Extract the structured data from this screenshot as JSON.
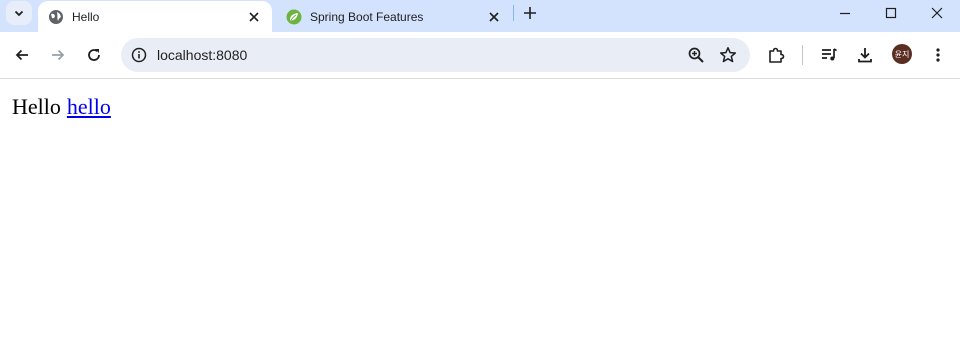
{
  "tabs": [
    {
      "title": "Hello",
      "favicon": "globe-icon",
      "active": true
    },
    {
      "title": "Spring Boot Features",
      "favicon": "spring-leaf-icon",
      "active": false
    }
  ],
  "address_bar": {
    "url": "localhost:8080"
  },
  "profile": {
    "avatar_text": "윤지",
    "color": "#5b2e22"
  },
  "page": {
    "text": "Hello",
    "link_text": "hello"
  },
  "colors": {
    "tabstrip": "#d3e3fd",
    "omnibox": "#e9eef6",
    "link": "#0000ee",
    "spring": "#6db33f"
  }
}
